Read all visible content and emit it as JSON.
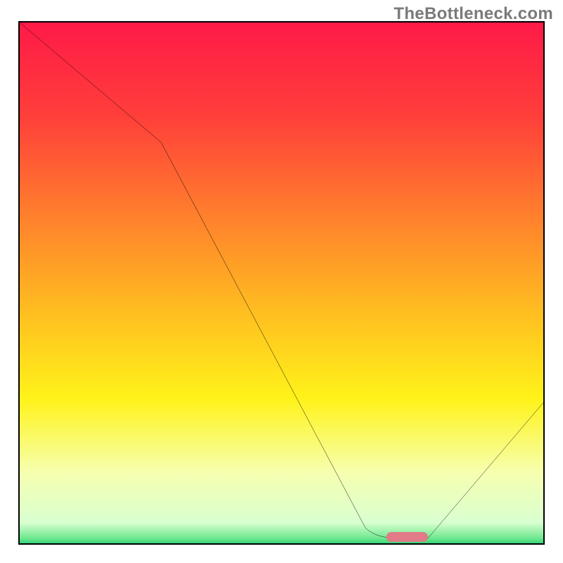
{
  "watermark": "TheBottleneck.com",
  "chart_data": {
    "type": "line",
    "title": "",
    "xlabel": "",
    "ylabel": "",
    "xlim": [
      0,
      100
    ],
    "ylim": [
      0,
      100
    ],
    "grid": false,
    "gradient_stops": [
      {
        "offset": 0,
        "color": "#ff1a48"
      },
      {
        "offset": 0.18,
        "color": "#ff3f3a"
      },
      {
        "offset": 0.4,
        "color": "#ff8a2a"
      },
      {
        "offset": 0.58,
        "color": "#ffc71f"
      },
      {
        "offset": 0.72,
        "color": "#fff31a"
      },
      {
        "offset": 0.86,
        "color": "#f6ffb0"
      },
      {
        "offset": 0.955,
        "color": "#d9ffd0"
      },
      {
        "offset": 0.985,
        "color": "#6fe88f"
      },
      {
        "offset": 1.0,
        "color": "#18c96b"
      }
    ],
    "series": [
      {
        "name": "bottleneck-curve",
        "x": [
          0,
          27,
          66,
          72,
          78,
          100
        ],
        "y": [
          100,
          77,
          3,
          1,
          1,
          27
        ]
      }
    ],
    "marker": {
      "name": "optimal-range",
      "x_start": 70,
      "x_end": 78,
      "y": 1,
      "color": "#e07b87"
    }
  }
}
